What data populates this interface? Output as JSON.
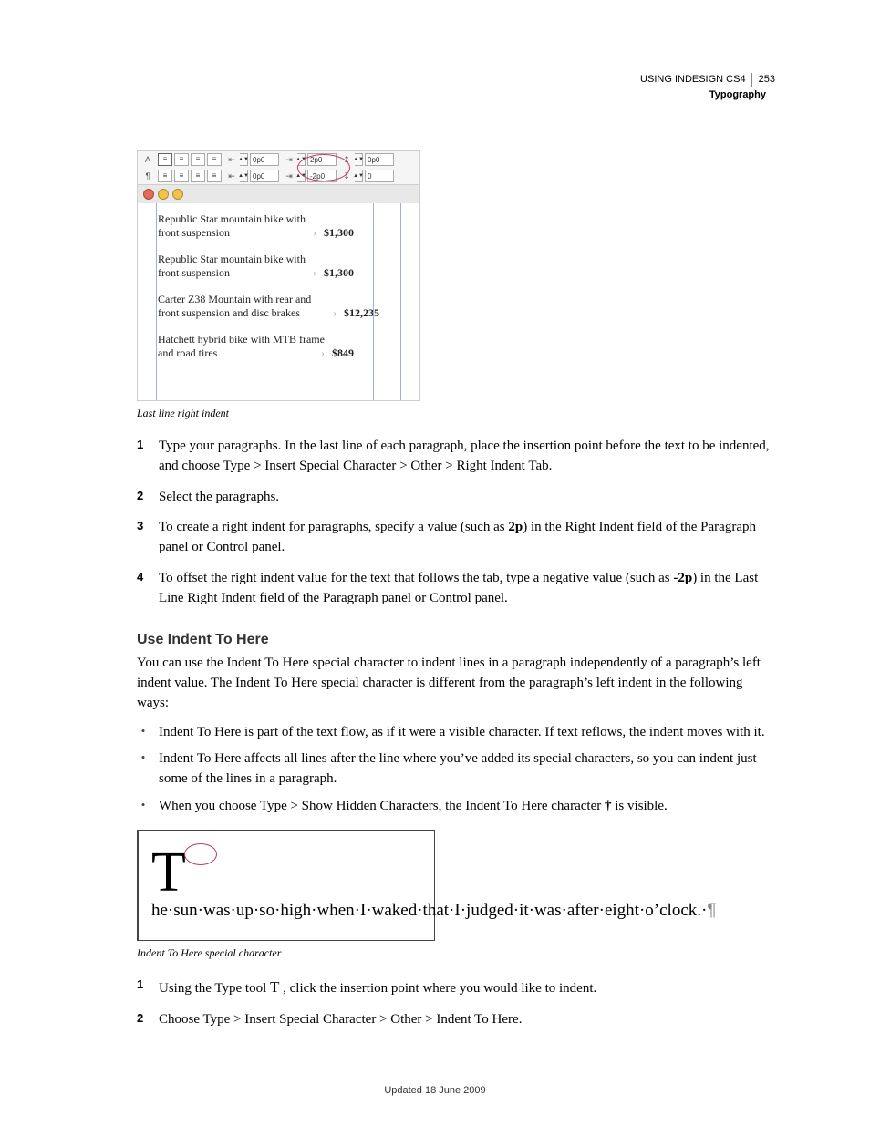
{
  "header": {
    "product": "USING INDESIGN CS4",
    "page_number": "253",
    "section": "Typography"
  },
  "figure1": {
    "cp": {
      "left_indent": "0p0",
      "first_line_indent": "0p0",
      "right_indent": "2p0",
      "last_line_right_indent": "-2p0",
      "space_before": "0p0",
      "space_after": "0"
    },
    "paras": [
      {
        "l1": "Republic Star mountain bike with",
        "l2": "front suspension",
        "price": "$1,300"
      },
      {
        "l1": "Republic Star mountain bike with",
        "l2": "front suspension",
        "price": "$1,300"
      },
      {
        "l1": "Carter Z38 Mountain with rear and",
        "l2": "front suspension and disc brakes",
        "price": "$12,235",
        "overrun": true
      },
      {
        "l1": "Hatchett hybrid bike with MTB frame",
        "l2": "and road tires",
        "price": "$849"
      }
    ],
    "caption": "Last line right indent"
  },
  "steps1": [
    "Type your paragraphs. In the last line of each paragraph, place the insertion point before the text to be indented, and choose Type > Insert Special Character > Other > Right Indent Tab.",
    "Select the paragraphs.",
    "To create a right indent for paragraphs, specify a value (such as 2p) in the Right Indent field of the Paragraph panel or Control panel.",
    "To offset the right indent value for the text that follows the tab, type a negative value (such as -2p) in the Last Line Right Indent field of the Paragraph panel or Control panel."
  ],
  "steps1_bold": {
    "2": "2p",
    "3": "-2p"
  },
  "section2": {
    "heading": "Use Indent To Here",
    "intro": "You can use the Indent To Here special character to indent lines in a paragraph independently of a paragraph’s left indent value. The Indent To Here special character is different from the paragraph’s left indent in the following ways:",
    "bullets": [
      "Indent To Here is part of the text flow, as if it were a visible character. If text reflows, the indent moves with it.",
      "Indent To Here affects all lines after the line where you’ve added its special characters, so you can indent just some of the lines in a paragraph.",
      "When you choose Type > Show Hidden Characters, the Indent To Here character † is visible."
    ]
  },
  "figure2": {
    "dropcap": "T",
    "text": "he sun was up so high when I waked that I judged it was after eight o’clock. ¶",
    "caption": "Indent To Here special character"
  },
  "steps2": [
    "Using the Type tool T , click the insertion point where you would like to indent.",
    "Choose Type > Insert Special Character > Other > Indent To Here."
  ],
  "footer": "Updated 18 June 2009"
}
